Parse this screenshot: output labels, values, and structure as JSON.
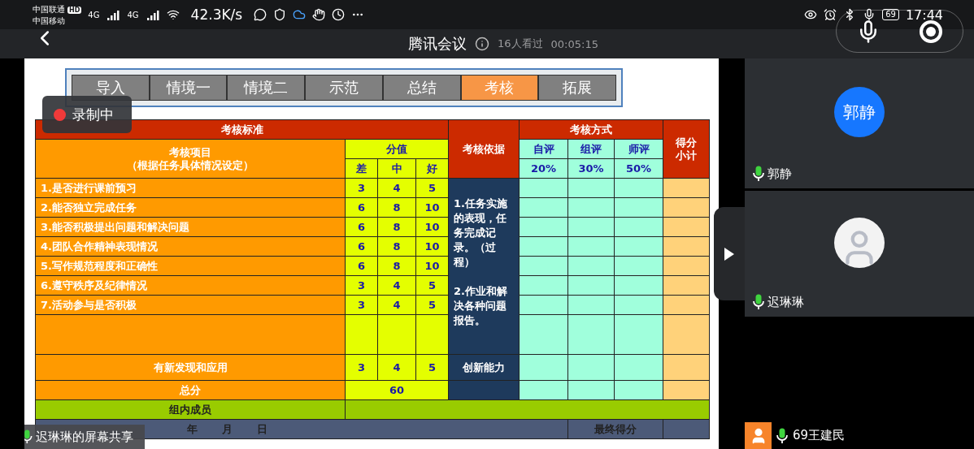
{
  "status_bar": {
    "carriers": [
      "中国联通",
      "中国移动"
    ],
    "hd_badge": "HD",
    "network_labels": [
      "4G",
      "4G"
    ],
    "speed": "42.3K/s",
    "battery": "69",
    "time": "17:44"
  },
  "title_bar": {
    "title": "腾讯会议",
    "viewers": "16人看过",
    "duration": "00:05:15"
  },
  "recording": {
    "label": "录制中"
  },
  "slide": {
    "nav_tabs": [
      {
        "label": "导入",
        "selected": false
      },
      {
        "label": "情境一",
        "selected": false
      },
      {
        "label": "情境二",
        "selected": false
      },
      {
        "label": "示范",
        "selected": false
      },
      {
        "label": "总结",
        "selected": false
      },
      {
        "label": "考核",
        "selected": true
      },
      {
        "label": "拓展",
        "selected": false
      }
    ],
    "table": {
      "standard_header": "考核标准",
      "item_header": "考核项目",
      "item_subheader": "（根据任务具体情况设定）",
      "score_header": "分值",
      "score_levels": [
        "差",
        "中",
        "好"
      ],
      "basis_header": "考核依据",
      "method_header": "考核方式",
      "methods": [
        {
          "name": "自评",
          "weight": "20%"
        },
        {
          "name": "组评",
          "weight": "30%"
        },
        {
          "name": "师评",
          "weight": "50%"
        }
      ],
      "subtotal_header": "得分小计",
      "rows": [
        {
          "item": "1.是否进行课前预习",
          "scores": [
            "3",
            "4",
            "5"
          ]
        },
        {
          "item": "2.能否独立完成任务",
          "scores": [
            "6",
            "8",
            "10"
          ]
        },
        {
          "item": "3.能否积极提出问题和解决问题",
          "scores": [
            "6",
            "8",
            "10"
          ]
        },
        {
          "item": "4.团队合作精神表现情况",
          "scores": [
            "6",
            "8",
            "10"
          ]
        },
        {
          "item": "5.写作规范程度和正确性",
          "scores": [
            "6",
            "8",
            "10"
          ]
        },
        {
          "item": "6.遵守秩序及纪律情况",
          "scores": [
            "3",
            "4",
            "5"
          ]
        },
        {
          "item": "7.活动参与是否积极",
          "scores": [
            "3",
            "4",
            "5"
          ]
        }
      ],
      "basis_notes": [
        "1.任务实施的表现，任务完成记录。（过程）",
        "2.作业和解决各种问题报告。"
      ],
      "innovation": {
        "item": "有新发现和应用",
        "scores": [
          "3",
          "4",
          "5"
        ],
        "basis": "创新能力"
      },
      "total": {
        "label": "总分",
        "value": "60"
      },
      "members_label": "组内成员",
      "signature": {
        "date_parts": [
          "年",
          "月",
          "日"
        ],
        "final_score_label": "最终得分"
      }
    }
  },
  "share_label": "迟琳琳的屏幕共享",
  "participants": [
    {
      "name": "郭静",
      "kind": "initials",
      "avatar_text": "郭静"
    },
    {
      "name": "迟琳琳",
      "kind": "picture"
    }
  ],
  "bottom_participant": {
    "name": "69王建民"
  }
}
